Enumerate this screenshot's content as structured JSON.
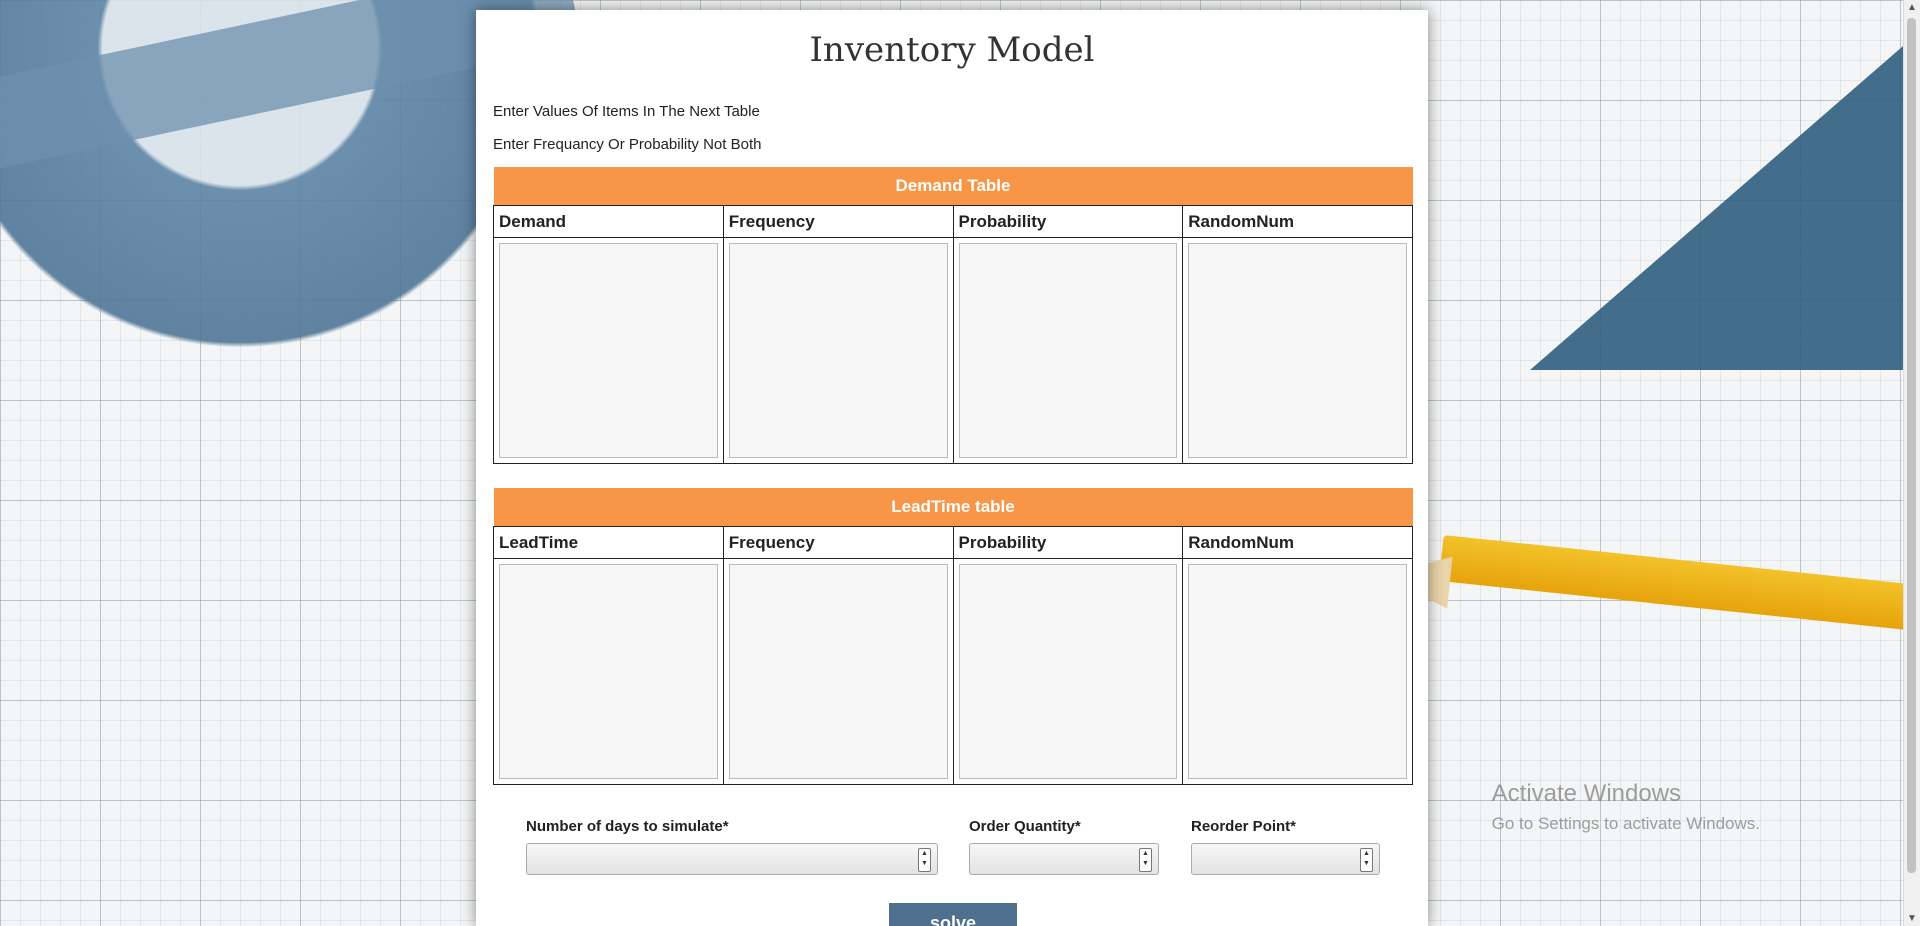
{
  "page": {
    "title": "Inventory Model",
    "instructions": [
      "Enter Values Of Items In The Next Table",
      "Enter Frequancy Or Probability Not Both"
    ]
  },
  "demand_table": {
    "caption": "Demand Table",
    "columns": [
      "Demand",
      "Frequency",
      "Probability",
      "RandomNum"
    ]
  },
  "leadtime_table": {
    "caption": "LeadTime table",
    "columns": [
      "LeadTime",
      "Frequency",
      "Probability",
      "RandomNum"
    ]
  },
  "inputs": {
    "days_label": "Number of days to simulate*",
    "days_value": "",
    "order_label": "Order Quantity*",
    "order_value": "",
    "reorder_label": "Reorder Point*",
    "reorder_value": ""
  },
  "actions": {
    "solve_label": "solve"
  },
  "watermark": {
    "line1": "Activate Windows",
    "line2": "Go to Settings to activate Windows."
  },
  "colors": {
    "table_header": "#f79646",
    "solve_button": "#4e6f8e"
  }
}
